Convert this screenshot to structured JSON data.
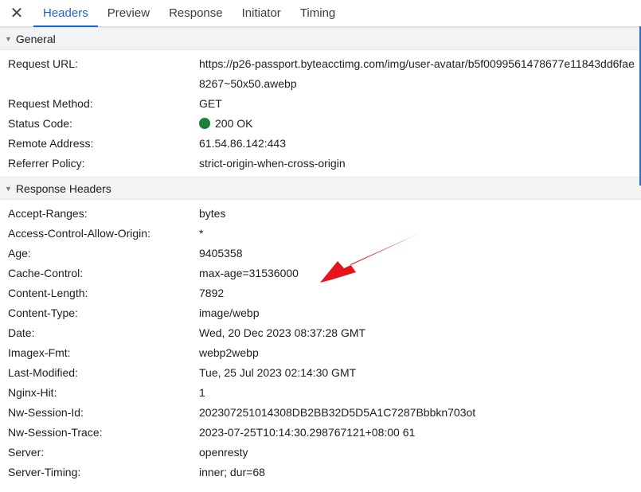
{
  "tabs": [
    {
      "label": "Headers"
    },
    {
      "label": "Preview"
    },
    {
      "label": "Response"
    },
    {
      "label": "Initiator"
    },
    {
      "label": "Timing"
    }
  ],
  "close_glyph": "✕",
  "general": {
    "title": "General",
    "rows": [
      {
        "key": "Request URL:",
        "value": "https://p26-passport.byteacctimg.com/img/user-avatar/b5f0099561478677e11843dd6fae8267~50x50.awebp"
      },
      {
        "key": "Request Method:",
        "value": "GET"
      },
      {
        "key": "Status Code:",
        "value": "200 OK",
        "status_color": "#1e7f37"
      },
      {
        "key": "Remote Address:",
        "value": "61.54.86.142:443"
      },
      {
        "key": "Referrer Policy:",
        "value": "strict-origin-when-cross-origin"
      }
    ]
  },
  "response_headers": {
    "title": "Response Headers",
    "rows": [
      {
        "key": "Accept-Ranges:",
        "value": "bytes"
      },
      {
        "key": "Access-Control-Allow-Origin:",
        "value": "*"
      },
      {
        "key": "Age:",
        "value": "9405358"
      },
      {
        "key": "Cache-Control:",
        "value": "max-age=31536000"
      },
      {
        "key": "Content-Length:",
        "value": "7892"
      },
      {
        "key": "Content-Type:",
        "value": "image/webp"
      },
      {
        "key": "Date:",
        "value": "Wed, 20 Dec 2023 08:37:28 GMT"
      },
      {
        "key": "Imagex-Fmt:",
        "value": "webp2webp"
      },
      {
        "key": "Last-Modified:",
        "value": "Tue, 25 Jul 2023 02:14:30 GMT"
      },
      {
        "key": "Nginx-Hit:",
        "value": "1"
      },
      {
        "key": "Nw-Session-Id:",
        "value": "202307251014308DB2BB32D5D5A1C7287Bbbkn703ot"
      },
      {
        "key": "Nw-Session-Trace:",
        "value": "2023-07-25T10:14:30.298767121+08:00 61"
      },
      {
        "key": "Server:",
        "value": "openresty"
      },
      {
        "key": "Server-Timing:",
        "value": "inner; dur=68"
      }
    ]
  },
  "colors": {
    "accent": "#1a63d3",
    "annotation_arrow": "#e8141b"
  }
}
